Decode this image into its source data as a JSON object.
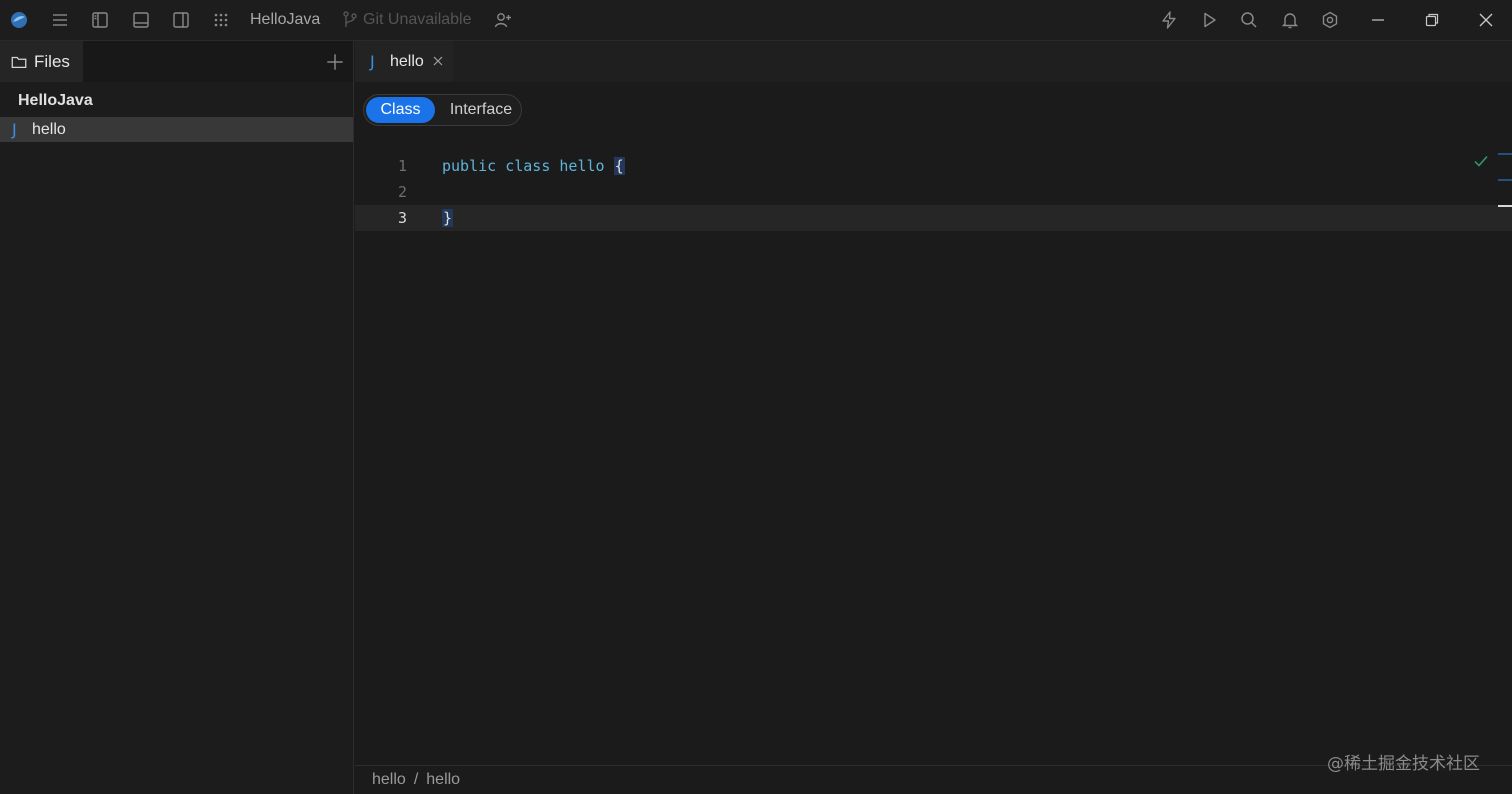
{
  "titlebar": {
    "project": "HelloJava",
    "git_status": "Git Unavailable"
  },
  "sidebar": {
    "tab_label": "Files",
    "project_name": "HelloJava",
    "files": [
      {
        "icon": "J",
        "name": "hello"
      }
    ]
  },
  "editor": {
    "tab": {
      "icon": "J",
      "label": "hello"
    },
    "segment": {
      "option_1": "Class",
      "option_2": "Interface",
      "selected": "Class"
    },
    "lines": [
      {
        "no": "1",
        "text_before": "public class hello ",
        "brace": "{"
      },
      {
        "no": "2",
        "text_before": "",
        "brace": ""
      },
      {
        "no": "3",
        "text_before": "",
        "brace": "}"
      }
    ]
  },
  "breadcrumb": {
    "part_1": "hello",
    "separator": "/",
    "part_2": "hello"
  },
  "watermark": "@稀土掘金技术社区",
  "colors": {
    "accent": "#1a73e8",
    "java_icon": "#3d8de0",
    "keyword": "#5fb3d9"
  }
}
